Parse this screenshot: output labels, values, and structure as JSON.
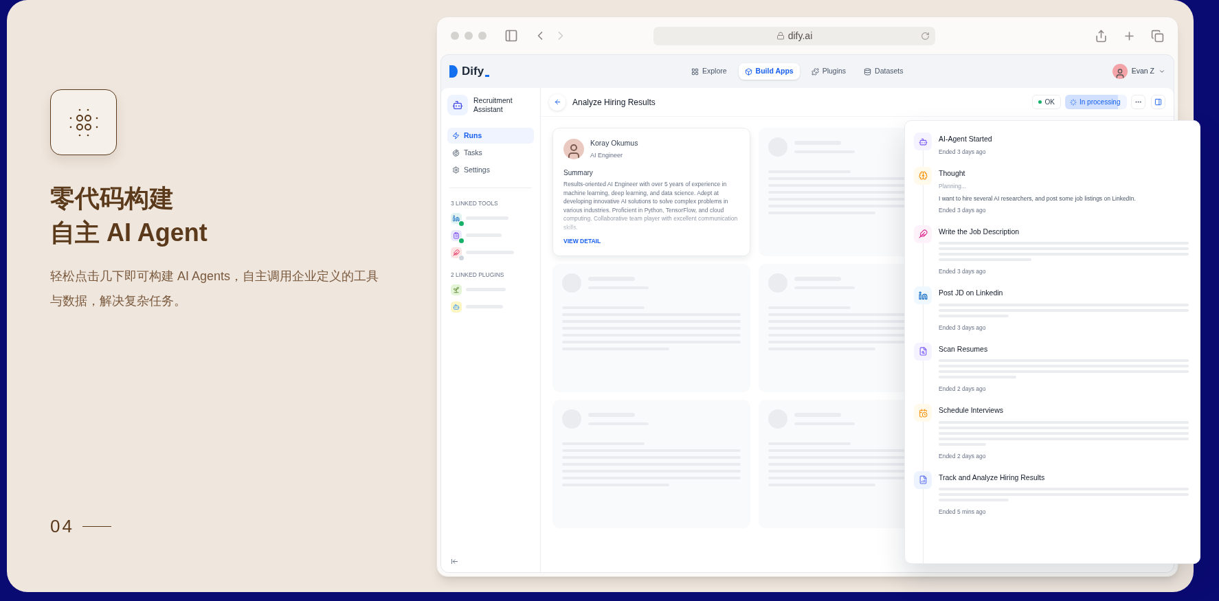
{
  "intro": {
    "title_lines": [
      "零代码构建",
      "自主 AI Agent"
    ],
    "description": "轻松点击几下即可构建 AI Agents，自主调用企业定义的工具与数据，解决复杂任务。",
    "step_number": "04"
  },
  "browser": {
    "url": "dify.ai"
  },
  "app": {
    "logo": "Dify",
    "nav": [
      {
        "label": "Explore",
        "selected": false
      },
      {
        "label": "Build Apps",
        "selected": true
      },
      {
        "label": "Plugins",
        "selected": false
      },
      {
        "label": "Datasets",
        "selected": false
      }
    ],
    "user": "Evan Z"
  },
  "sidebar": {
    "app_name": "Recruitment Assistant",
    "items": [
      {
        "label": "Runs",
        "selected": true
      },
      {
        "label": "Tasks",
        "selected": false
      },
      {
        "label": "Settings",
        "selected": false
      }
    ],
    "tools_heading": "3 LINKED TOOLS",
    "tools": [
      {
        "color": "#17b26a"
      },
      {
        "color": "#17b26a"
      },
      {
        "color": "#d0d5dd"
      }
    ],
    "plugins_heading": "2 LINKED PLUGINS"
  },
  "page": {
    "title": "Analyze Hiring Results",
    "status": "OK",
    "progress": {
      "label": "In processing",
      "level": 0.85
    }
  },
  "candidate": {
    "name": "Koray Okumus",
    "role": "AI Engineer",
    "summary_heading": "Summary",
    "summary": "Results-oriented AI Engineer with over 5 years of experience in machine learning, deep learning, and data science. Adept at developing innovative AI solutions to solve complex problems in various industries. Proficient in Python, TensorFlow, and cloud computing. Collaborative team player with excellent communication skills.",
    "link": "VIEW DETAIL"
  },
  "timeline": [
    {
      "kind": "agent",
      "title": "AI-Agent Started",
      "ended": "Ended 3 days ago"
    },
    {
      "kind": "thought",
      "title": "Thought",
      "status": "Planning...",
      "message": "I want to hire several AI researchers, and post some job listings on LinkedIn.",
      "ended": "Ended 3 days ago"
    },
    {
      "kind": "write",
      "title": "Write the Job Description",
      "ended": "Ended 3 days ago"
    },
    {
      "kind": "linkedin",
      "title": "Post JD on Linkedin",
      "ended": "Ended 3 days ago"
    },
    {
      "kind": "scan",
      "title": "Scan Resumes",
      "ended": "Ended 2 days ago"
    },
    {
      "kind": "calendar",
      "title": "Schedule Interviews",
      "ended": "Ended 2 days ago"
    },
    {
      "kind": "analyze",
      "title": "Track and Analyze Hiring Results",
      "ended": "Ended 5 mins ago"
    }
  ]
}
